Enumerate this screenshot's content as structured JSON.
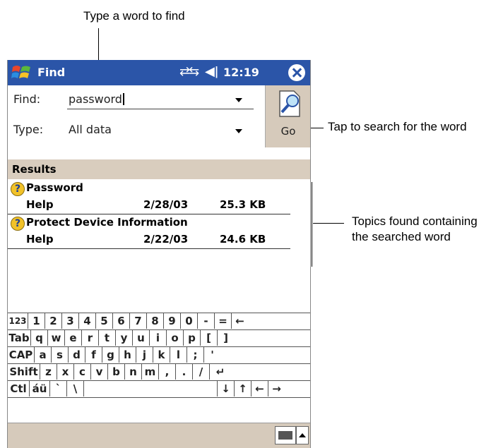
{
  "annotations": {
    "find_word": "Type a word to find",
    "tap_search": "Tap to search for the word",
    "topics_line1": "Topics found containing",
    "topics_line2": "the searched word"
  },
  "titlebar": {
    "app_title": "Find",
    "time": "12:19",
    "icons": [
      "windows-start-icon",
      "connectivity-icon",
      "volume-icon",
      "close-icon"
    ],
    "color": "#2b55a8"
  },
  "search": {
    "find_label": "Find:",
    "find_value": "password",
    "type_label": "Type:",
    "type_value": "All data",
    "go_label": "Go"
  },
  "results": {
    "header": "Results",
    "items": [
      {
        "title": "Password",
        "type": "Help",
        "date": "2/28/03",
        "size": "25.3 KB"
      },
      {
        "title": "Protect Device Information",
        "type": "Help",
        "date": "2/22/03",
        "size": "24.6 KB"
      }
    ]
  },
  "keyboard": {
    "rows": [
      [
        "123",
        "1",
        "2",
        "3",
        "4",
        "5",
        "6",
        "7",
        "8",
        "9",
        "0",
        "-",
        "=",
        "←"
      ],
      [
        "Tab",
        "q",
        "w",
        "e",
        "r",
        "t",
        "y",
        "u",
        "i",
        "o",
        "p",
        "[",
        "]"
      ],
      [
        "CAP",
        "a",
        "s",
        "d",
        "f",
        "g",
        "h",
        "j",
        "k",
        "l",
        ";",
        "'"
      ],
      [
        "Shift",
        "z",
        "x",
        "c",
        "v",
        "b",
        "n",
        "m",
        ",",
        ".",
        "/",
        "↵"
      ],
      [
        "Ctl",
        "áü",
        "`",
        "\\",
        " ",
        "↓",
        "↑",
        "←",
        "→"
      ]
    ]
  },
  "colors": {
    "menubar": "#d6cabb",
    "results_header": "#d9cdbe",
    "help_icon": "#f2c229"
  }
}
